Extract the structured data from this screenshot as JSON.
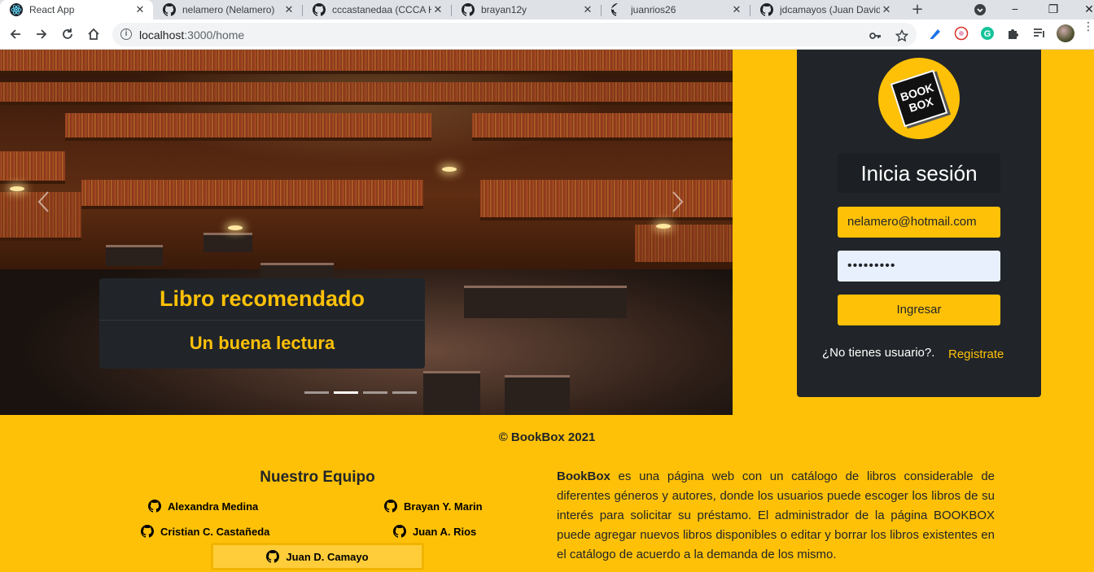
{
  "browser": {
    "tabs": [
      {
        "title": "React App",
        "icon": "react-icon"
      },
      {
        "title": "nelamero (Nelamero)",
        "icon": "github-icon"
      },
      {
        "title": "cccastanedaa (CCCA H",
        "icon": "github-icon"
      },
      {
        "title": "brayan12y",
        "icon": "github-icon"
      },
      {
        "title": "juanrios26",
        "icon": "github-icon"
      },
      {
        "title": "jdcamayos (Juan David",
        "icon": "github-icon"
      }
    ],
    "url_host": "localhost",
    "url_path": ":3000/home"
  },
  "carousel": {
    "caption_title": "Libro recomendado",
    "caption_subtitle": "Un buena lectura",
    "active_slide": 2,
    "slide_count": 4
  },
  "login": {
    "logo_line1": "BOOK",
    "logo_line2": "BOX",
    "title": "Inicia sesión",
    "email_value": "nelamero@hotmail.com",
    "password_mask": "•••••••••",
    "submit_label": "Ingresar",
    "no_user_text": "¿No tienes usuario?.",
    "register_link": "Registrate"
  },
  "footer": {
    "copyright": "© BookBox 2021",
    "team_title": "Nuestro Equipo",
    "members": [
      "Alexandra Medina",
      "Brayan Y. Marin",
      "Cristian C. Castañeda",
      "Juan A. Rios",
      "Juan D. Camayo"
    ],
    "about_brand": "BookBox",
    "about_text": " es una página web con un catálogo de libros considerable de diferentes géneros y autores, donde los usuarios puede escoger los libros de su interés para solicitar su préstamo. El administrador de la página BOOKBOX puede agregar nuevos libros disponibles o editar y borrar los libros existentes en el catálogo de acuerdo a la demanda de los mismo."
  },
  "colors": {
    "accent": "#ffc107",
    "dark": "#212529"
  }
}
